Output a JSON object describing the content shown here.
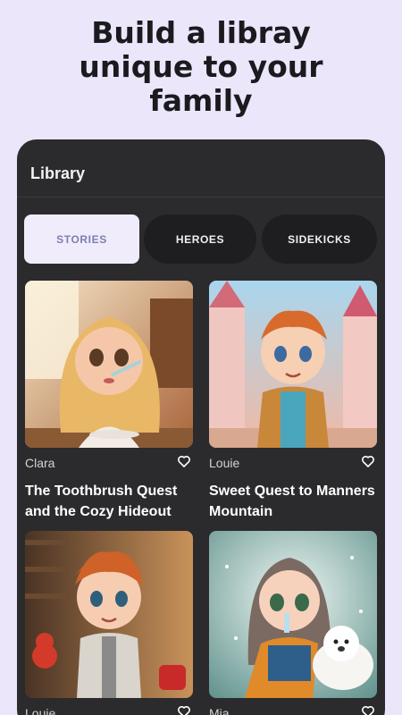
{
  "headline": {
    "line1": "Build a libray",
    "line2": "unique to your",
    "line3": "family"
  },
  "panel": {
    "title": "Library"
  },
  "tabs": [
    {
      "label": "STORIES",
      "active": true
    },
    {
      "label": "HEROES",
      "active": false
    },
    {
      "label": "SIDEKICKS",
      "active": false
    }
  ],
  "stories": [
    {
      "author": "Clara",
      "title": "The Toothbrush Quest and the Cozy Hideout",
      "favorited": false,
      "icon": "heart-outline-icon"
    },
    {
      "author": "Louie",
      "title": "Sweet Quest to Manners Mountain",
      "favorited": false,
      "icon": "heart-outline-icon"
    },
    {
      "author": "Louie",
      "title": "",
      "favorited": false,
      "icon": "heart-outline-icon"
    },
    {
      "author": "Mia",
      "title": "",
      "favorited": false,
      "icon": "heart-outline-icon"
    }
  ],
  "colors": {
    "background": "#ece6fb",
    "panel": "#2b2b2d",
    "tab_active_bg": "#f0ecfb",
    "tab_active_text": "#7d7fb0",
    "tab_inactive_bg": "#1e1e20"
  }
}
